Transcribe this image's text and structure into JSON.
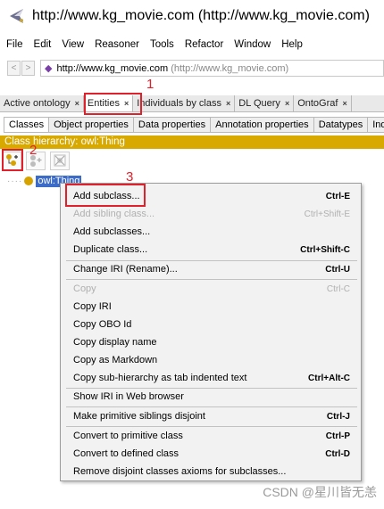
{
  "window": {
    "title": "http://www.kg_movie.com (http://www.kg_movie.com)",
    "icon": "protege-icon"
  },
  "menu": [
    "File",
    "Edit",
    "View",
    "Reasoner",
    "Tools",
    "Refactor",
    "Window",
    "Help"
  ],
  "urlbar": {
    "back_icon": "chevron-left-icon",
    "forward_icon": "chevron-right-icon",
    "url": "http://www.kg_movie.com",
    "hint": "(http://www.kg_movie.com)"
  },
  "tabs": [
    {
      "label": "Active ontology",
      "close": "×"
    },
    {
      "label": "Entities",
      "close": "×"
    },
    {
      "label": "Individuals by class",
      "close": "×"
    },
    {
      "label": "DL Query",
      "close": "×"
    },
    {
      "label": "OntoGraf",
      "close": "×"
    }
  ],
  "subtabs": [
    "Classes",
    "Object properties",
    "Data properties",
    "Annotation properties",
    "Datatypes",
    "Indiv"
  ],
  "hierarchy_header": "Class hierarchy: owl:Thing",
  "toolbar": [
    "add-subclass-icon",
    "add-sibling-icon",
    "delete-class-icon"
  ],
  "tree": {
    "root": "owl:Thing"
  },
  "annotations": [
    "1",
    "2",
    "3"
  ],
  "context_menu": [
    {
      "label": "Add subclass...",
      "shortcut": "Ctrl-E",
      "enabled": true
    },
    {
      "label": "Add sibling class...",
      "shortcut": "Ctrl+Shift-E",
      "enabled": false
    },
    {
      "label": "Add subclasses...",
      "shortcut": "",
      "enabled": true
    },
    {
      "label": "Duplicate class...",
      "shortcut": "Ctrl+Shift-C",
      "enabled": true
    },
    {
      "label": "Change IRI (Rename)...",
      "shortcut": "Ctrl-U",
      "enabled": true
    },
    {
      "label": "Copy",
      "shortcut": "Ctrl-C",
      "enabled": false
    },
    {
      "label": "Copy IRI",
      "shortcut": "",
      "enabled": true
    },
    {
      "label": "Copy OBO Id",
      "shortcut": "",
      "enabled": true
    },
    {
      "label": "Copy display name",
      "shortcut": "",
      "enabled": true
    },
    {
      "label": "Copy as Markdown",
      "shortcut": "",
      "enabled": true
    },
    {
      "label": "Copy sub-hierarchy as tab indented text",
      "shortcut": "Ctrl+Alt-C",
      "enabled": true
    },
    {
      "label": "Show IRI in Web browser",
      "shortcut": "",
      "enabled": true
    },
    {
      "label": "Make primitive siblings disjoint",
      "shortcut": "Ctrl-J",
      "enabled": true
    },
    {
      "label": "Convert to primitive class",
      "shortcut": "Ctrl-P",
      "enabled": true
    },
    {
      "label": "Convert to defined class",
      "shortcut": "Ctrl-D",
      "enabled": true
    },
    {
      "label": "Remove disjoint classes axioms for subclasses...",
      "shortcut": "",
      "enabled": true
    }
  ],
  "watermark": "CSDN @星川皆无恙",
  "colors": {
    "hierarchy_header": "#d8a900",
    "selection": "#3c6cc8",
    "annotation": "#e0202a"
  }
}
